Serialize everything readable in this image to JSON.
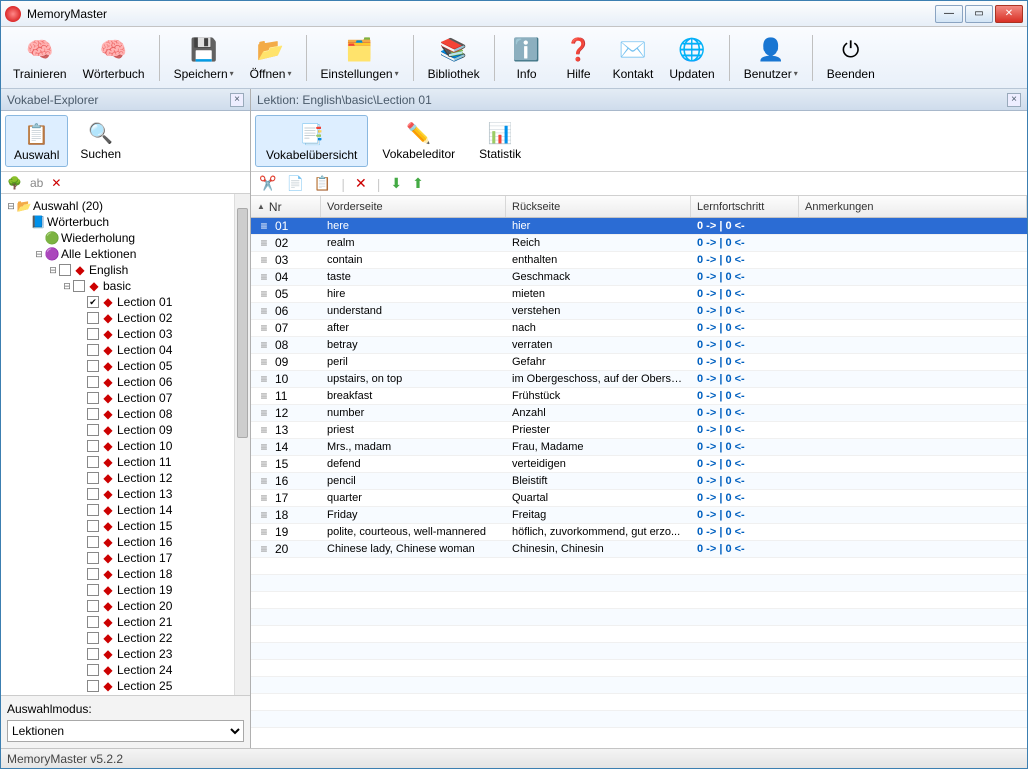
{
  "window": {
    "title": "MemoryMaster"
  },
  "toolbar": [
    {
      "name": "trainieren",
      "label": "Trainieren",
      "icon": "🧠",
      "drop": false
    },
    {
      "name": "woerterbuch",
      "label": "Wörterbuch",
      "icon": "🧠",
      "drop": false
    },
    {
      "sep": true
    },
    {
      "name": "speichern",
      "label": "Speichern",
      "icon": "💾",
      "drop": true
    },
    {
      "name": "oeffnen",
      "label": "Öffnen",
      "icon": "📂",
      "drop": true
    },
    {
      "sep": true
    },
    {
      "name": "einstellungen",
      "label": "Einstellungen",
      "icon": "🗂️",
      "drop": true
    },
    {
      "sep": true
    },
    {
      "name": "bibliothek",
      "label": "Bibliothek",
      "icon": "📚",
      "drop": false
    },
    {
      "sep": true
    },
    {
      "name": "info",
      "label": "Info",
      "icon": "ℹ️",
      "drop": false
    },
    {
      "name": "hilfe",
      "label": "Hilfe",
      "icon": "❓",
      "drop": false
    },
    {
      "name": "kontakt",
      "label": "Kontakt",
      "icon": "✉️",
      "drop": false
    },
    {
      "name": "updaten",
      "label": "Updaten",
      "icon": "🌐",
      "drop": false
    },
    {
      "sep": true
    },
    {
      "name": "benutzer",
      "label": "Benutzer",
      "icon": "👤",
      "drop": true
    },
    {
      "sep": true
    },
    {
      "name": "beenden",
      "label": "Beenden",
      "icon": "⏻",
      "drop": false
    }
  ],
  "explorer": {
    "title": "Vokabel-Explorer",
    "tools": [
      {
        "name": "auswahl",
        "label": "Auswahl",
        "icon": "📋",
        "sel": true
      },
      {
        "name": "suchen",
        "label": "Suchen",
        "icon": "🔍",
        "sel": false
      }
    ],
    "root": "Auswahl (20)",
    "top_items": [
      {
        "label": "Wörterbuch",
        "icon": "📘",
        "indent": 1
      },
      {
        "label": "Wiederholung",
        "icon": "🟢",
        "indent": 2,
        "ic_class": "green"
      },
      {
        "label": "Alle Lektionen",
        "icon": "🟣",
        "indent": 2,
        "ic_class": "purple",
        "exp": "⊟"
      },
      {
        "label": "English",
        "icon": "◆",
        "indent": 3,
        "ic_class": "red",
        "exp": "⊟",
        "cb": true
      },
      {
        "label": "basic",
        "icon": "◆",
        "indent": 4,
        "ic_class": "red",
        "exp": "⊟",
        "cb": true
      }
    ],
    "lections": [
      "Lection 01",
      "Lection 02",
      "Lection 03",
      "Lection 04",
      "Lection 05",
      "Lection 06",
      "Lection 07",
      "Lection 08",
      "Lection 09",
      "Lection 10",
      "Lection 11",
      "Lection 12",
      "Lection 13",
      "Lection 14",
      "Lection 15",
      "Lection 16",
      "Lection 17",
      "Lection 18",
      "Lection 19",
      "Lection 20",
      "Lection 21",
      "Lection 22",
      "Lection 23",
      "Lection 24",
      "Lection 25"
    ],
    "checked_lection": "Lection 01",
    "mode_label": "Auswahlmodus:",
    "mode_value": "Lektionen"
  },
  "lesson": {
    "title": "Lektion: English\\basic\\Lection 01",
    "tabs": [
      {
        "name": "uebersicht",
        "label": "Vokabelübersicht",
        "icon": "📑",
        "sel": true
      },
      {
        "name": "editor",
        "label": "Vokabeleditor",
        "icon": "✏️",
        "sel": false
      },
      {
        "name": "statistik",
        "label": "Statistik",
        "icon": "📊",
        "sel": false
      }
    ],
    "columns": {
      "nr": "Nr",
      "front": "Vorderseite",
      "back": "Rückseite",
      "progress": "Lernfortschritt",
      "notes": "Anmerkungen"
    },
    "rows": [
      {
        "nr": "01",
        "front": "here",
        "back": "hier",
        "prog": "0 ->  | 0 <-",
        "sel": true
      },
      {
        "nr": "02",
        "front": "realm",
        "back": "Reich",
        "prog": "0 ->  | 0 <-"
      },
      {
        "nr": "03",
        "front": "contain",
        "back": "enthalten",
        "prog": "0 ->  | 0 <-"
      },
      {
        "nr": "04",
        "front": "taste",
        "back": "Geschmack",
        "prog": "0 ->  | 0 <-"
      },
      {
        "nr": "05",
        "front": "hire",
        "back": "mieten",
        "prog": "0 ->  | 0 <-"
      },
      {
        "nr": "06",
        "front": "understand",
        "back": "verstehen",
        "prog": "0 ->  | 0 <-"
      },
      {
        "nr": "07",
        "front": "after",
        "back": "nach",
        "prog": "0 ->  | 0 <-"
      },
      {
        "nr": "08",
        "front": "betray",
        "back": "verraten",
        "prog": "0 ->  | 0 <-"
      },
      {
        "nr": "09",
        "front": "peril",
        "back": "Gefahr",
        "prog": "0 ->  | 0 <-"
      },
      {
        "nr": "10",
        "front": "upstairs, on top",
        "back": "im Obergeschoss, auf der Oberseite",
        "prog": "0 ->  | 0 <-"
      },
      {
        "nr": "11",
        "front": "breakfast",
        "back": "Frühstück",
        "prog": "0 ->  | 0 <-"
      },
      {
        "nr": "12",
        "front": "number",
        "back": "Anzahl",
        "prog": "0 ->  | 0 <-"
      },
      {
        "nr": "13",
        "front": "priest",
        "back": "Priester",
        "prog": "0 ->  | 0 <-"
      },
      {
        "nr": "14",
        "front": "Mrs., madam",
        "back": "Frau, Madame",
        "prog": "0 ->  | 0 <-"
      },
      {
        "nr": "15",
        "front": "defend",
        "back": "verteidigen",
        "prog": "0 ->  | 0 <-"
      },
      {
        "nr": "16",
        "front": "pencil",
        "back": "Bleistift",
        "prog": "0 ->  | 0 <-"
      },
      {
        "nr": "17",
        "front": "quarter",
        "back": "Quartal",
        "prog": "0 ->  | 0 <-"
      },
      {
        "nr": "18",
        "front": "Friday",
        "back": "Freitag",
        "prog": "0 ->  | 0 <-"
      },
      {
        "nr": "19",
        "front": "polite, courteous, well-mannered",
        "back": "höflich, zuvorkommend, gut erzo...",
        "prog": "0 ->  | 0 <-"
      },
      {
        "nr": "20",
        "front": "Chinese lady, Chinese woman",
        "back": "Chinesin, Chinesin",
        "prog": "0 ->  | 0 <-"
      }
    ]
  },
  "status": "MemoryMaster v5.2.2"
}
